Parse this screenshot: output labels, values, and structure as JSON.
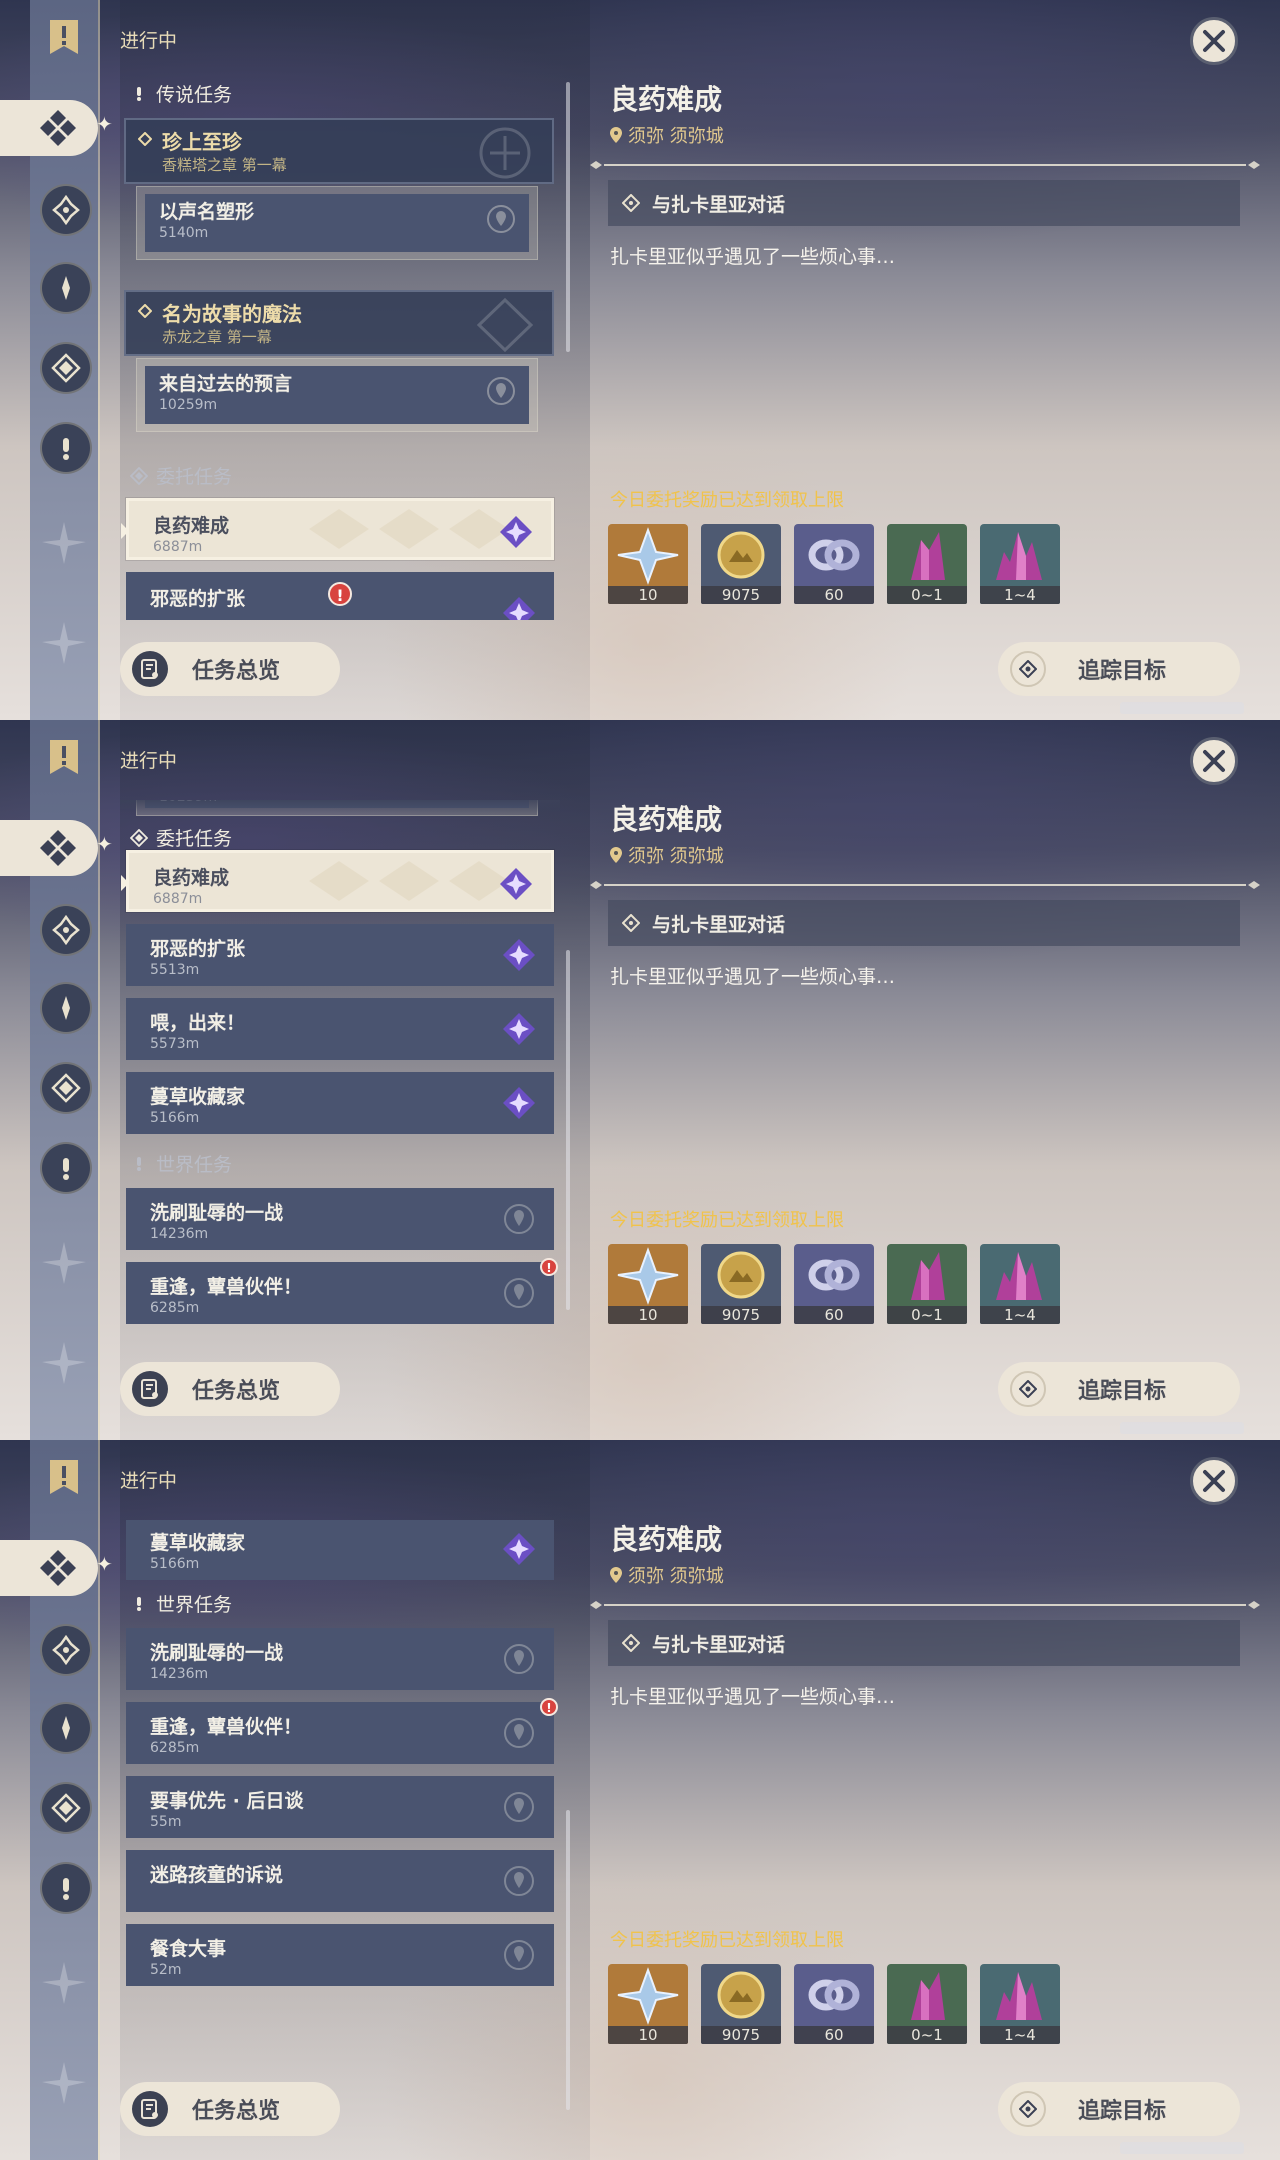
{
  "header": {
    "status": "进行中"
  },
  "colors": {
    "accent_gold": "#f0c34c",
    "cream": "#ece5d8",
    "panel": "#4a5470",
    "alert": "#d8433e"
  },
  "detail": {
    "title": "良药难成",
    "location": "须弥 须弥城",
    "objective": "与扎卡里亚对话",
    "description": "扎卡里亚似乎遇见了一些烦心事…",
    "limit_notice": "今日委托奖励已达到领取上限",
    "rewards": [
      {
        "icon": "primogem-icon",
        "count": "10"
      },
      {
        "icon": "mora-icon",
        "count": "9075"
      },
      {
        "icon": "fate-icon",
        "count": "60"
      },
      {
        "icon": "crystal-icon",
        "count": "0~1"
      },
      {
        "icon": "crystal-cluster-icon",
        "count": "1~4"
      }
    ]
  },
  "buttons": {
    "overview": "任务总览",
    "track": "追踪目标"
  },
  "categories": {
    "legend": "传说任务",
    "commission": "委托任务",
    "world": "世界任务"
  },
  "legend_quests": [
    {
      "title": "珍上至珍",
      "chapter": "香糕塔之章 第一幕",
      "step": "以声名塑形",
      "distance": "5140m"
    },
    {
      "title": "名为故事的魔法",
      "chapter": "赤龙之章 第一幕",
      "step": "来自过去的预言",
      "distance": "10259m"
    }
  ],
  "commissions": [
    {
      "title": "良药难成",
      "distance": "6887m"
    },
    {
      "title": "邪恶的扩张",
      "distance": "5513m"
    },
    {
      "title": "喂，出来！",
      "distance": "5573m"
    },
    {
      "title": "蔓草收藏家",
      "distance": "5166m"
    }
  ],
  "world_quests": [
    {
      "title": "洗刷耻辱的一战",
      "distance": "14236m"
    },
    {
      "title": "重逢，蕈兽伙伴！",
      "distance": "6285m"
    },
    {
      "title": "要事优先 · 后日谈",
      "distance": "55m"
    },
    {
      "title": "迷路孩童的诉说",
      "distance": ""
    },
    {
      "title": "餐食大事",
      "distance": "52m"
    }
  ]
}
